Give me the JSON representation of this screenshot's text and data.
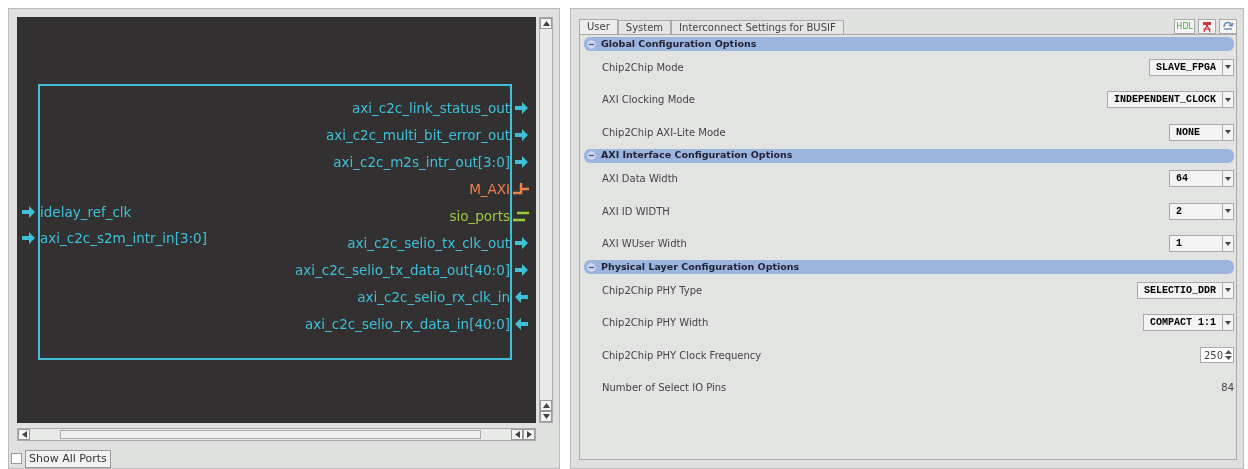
{
  "diagram": {
    "left_ports": [
      {
        "name": "idelay_ref_clk",
        "kind": "in",
        "color": "#3fc0d8"
      },
      {
        "name": "axi_c2c_s2m_intr_in[3:0]",
        "kind": "in",
        "color": "#3fc0d8"
      }
    ],
    "right_ports": [
      {
        "name": "axi_c2c_link_status_out",
        "kind": "out",
        "color": "#3fc0d8"
      },
      {
        "name": "axi_c2c_multi_bit_error_out",
        "kind": "out",
        "color": "#3fc0d8"
      },
      {
        "name": "axi_c2c_m2s_intr_out[3:0]",
        "kind": "out",
        "color": "#3fc0d8"
      },
      {
        "name": "M_AXI",
        "kind": "bus",
        "color": "#f0824a"
      },
      {
        "name": "sio_ports",
        "kind": "plain",
        "color": "#9ccc3c"
      },
      {
        "name": "axi_c2c_selio_tx_clk_out",
        "kind": "out",
        "color": "#3fc0d8"
      },
      {
        "name": "axi_c2c_selio_tx_data_out[40:0]",
        "kind": "out",
        "color": "#3fc0d8"
      },
      {
        "name": "axi_c2c_selio_rx_clk_in",
        "kind": "in",
        "color": "#3fc0d8"
      },
      {
        "name": "axi_c2c_selio_rx_data_in[40:0]",
        "kind": "in",
        "color": "#3fc0d8"
      }
    ]
  },
  "show_all_ports": {
    "label": "Show All Ports",
    "checked": false
  },
  "tabs": [
    {
      "label": "User",
      "selected": true
    },
    {
      "label": "System",
      "selected": false
    },
    {
      "label": "Interconnect Settings for BUSIF",
      "selected": false
    }
  ],
  "hdl_button": {
    "label": "HDL"
  },
  "sections": [
    {
      "title": "Global Configuration Options",
      "expanded": true,
      "rows": [
        {
          "label": "Chip2Chip Mode",
          "kind": "select",
          "value": "SLAVE_FPGA"
        },
        {
          "label": "AXI Clocking Mode",
          "kind": "select",
          "value": "INDEPENDENT_CLOCK"
        },
        {
          "label": "Chip2Chip AXI-Lite Mode",
          "kind": "select",
          "value": "NONE"
        }
      ]
    },
    {
      "title": "AXI Interface Configuration Options",
      "expanded": true,
      "rows": [
        {
          "label": "AXI Data Width",
          "kind": "select",
          "value": "64"
        },
        {
          "label": "AXI ID WIDTH",
          "kind": "select",
          "value": "2"
        },
        {
          "label": "AXI WUser Width",
          "kind": "select",
          "value": "1"
        }
      ]
    },
    {
      "title": "Physical Layer Configuration Options",
      "expanded": true,
      "rows": [
        {
          "label": "Chip2Chip PHY Type",
          "kind": "select",
          "value": "SELECTIO_DDR"
        },
        {
          "label": "Chip2Chip PHY Width",
          "kind": "select",
          "value": "COMPACT 1:1"
        },
        {
          "label": "Chip2Chip PHY Clock Frequency",
          "kind": "spin",
          "value": "250"
        },
        {
          "label": "Number of Select IO Pins",
          "kind": "text",
          "value": "84"
        }
      ]
    }
  ]
}
